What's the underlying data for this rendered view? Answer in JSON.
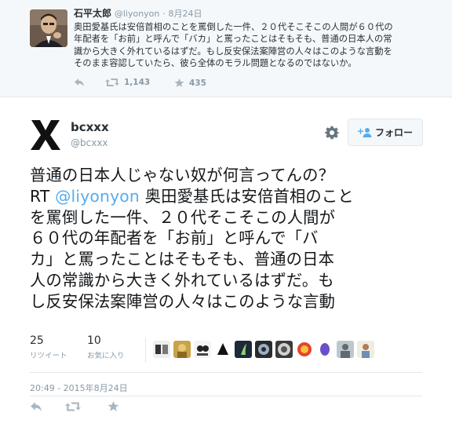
{
  "quoted_tweet": {
    "name": "石平太郎",
    "handle": "@liyonyon",
    "dot": "·",
    "date": "8月24日",
    "text_lines": [
      "奥田愛基氏は安倍首相のことを罵倒した一件、２０代そこそこの人間が６０代の",
      "年配者を「お前」と呼んで「バカ」と罵ったことはそもそも、普通の日本人の常",
      "識から大きく外れているはずだ。もし反安保法案陣営の人々はこのような言動を",
      "そのまま容認していたら、彼ら全体のモラル問題となるのではないか。"
    ],
    "retweet_count": "1,143",
    "like_count": "435"
  },
  "tweet": {
    "name": "bcxxx",
    "handle": "@bcxxx",
    "follow_label": "フォロー",
    "lines": [
      "普通の日本人じゃない奴が何言ってんの？",
      "奥田愛基氏は安倍首相のこと",
      "を罵倒した一件、２０代そこそこの人間が",
      "６０代の年配者を「お前」と呼んで「バ",
      "カ」と罵ったことはそもそも、普通の日本",
      "人の常識から大きく外れているはずだ。も",
      "し反安保法案陣営の人々はこのような言動"
    ],
    "rt_prefix": "RT ",
    "mention": "@liyonyon",
    "retweets": {
      "count": "25",
      "label": "リツイート"
    },
    "likes": {
      "count": "10",
      "label": "お気に入り"
    },
    "timestamp": "20:49 - 2015年8月24日"
  },
  "colors": {
    "accent": "#55acee",
    "muted": "#8899a6",
    "text": "#292f33",
    "border": "#e1e8ed",
    "quoted_bg": "#f5f8fa"
  },
  "icons": {
    "reply": "reply-icon",
    "retweet": "retweet-icon",
    "favorite": "star-icon",
    "settings": "gear-icon",
    "follow": "add-user-icon"
  }
}
